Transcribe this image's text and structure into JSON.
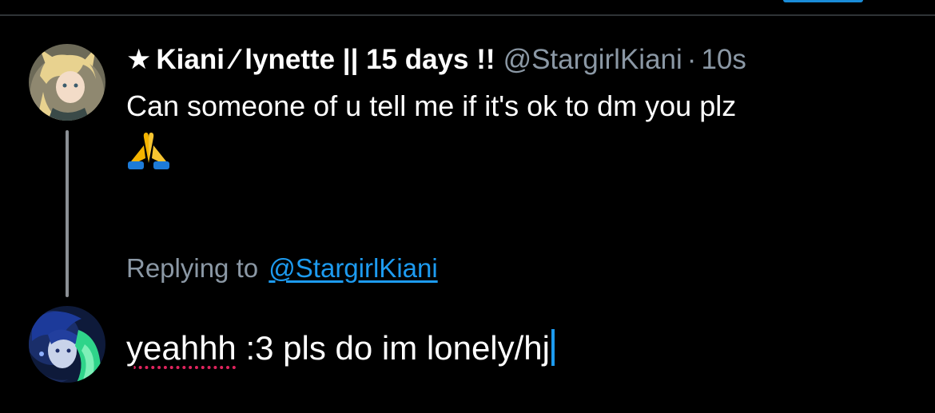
{
  "original_tweet": {
    "display_name": "Kiani ⁄ lynette || 15 days !!",
    "star_symbol": "★",
    "handle": "@StargirlKiani",
    "separator": "·",
    "timestamp": "10s",
    "text": "Can someone of u tell me if it's ok to dm you plz",
    "emoji": "folded-hands-icon"
  },
  "reply": {
    "replying_prefix": "Replying to",
    "replying_handle": "@StargirlKiani",
    "draft_misspelled_word": "yeahhh",
    "draft_rest": " :3 pls do im lonely/hj"
  },
  "colors": {
    "background": "#000000",
    "accent": "#1d9bf0",
    "muted_text": "#8b98a5",
    "spellcheck": "#e0245e"
  }
}
